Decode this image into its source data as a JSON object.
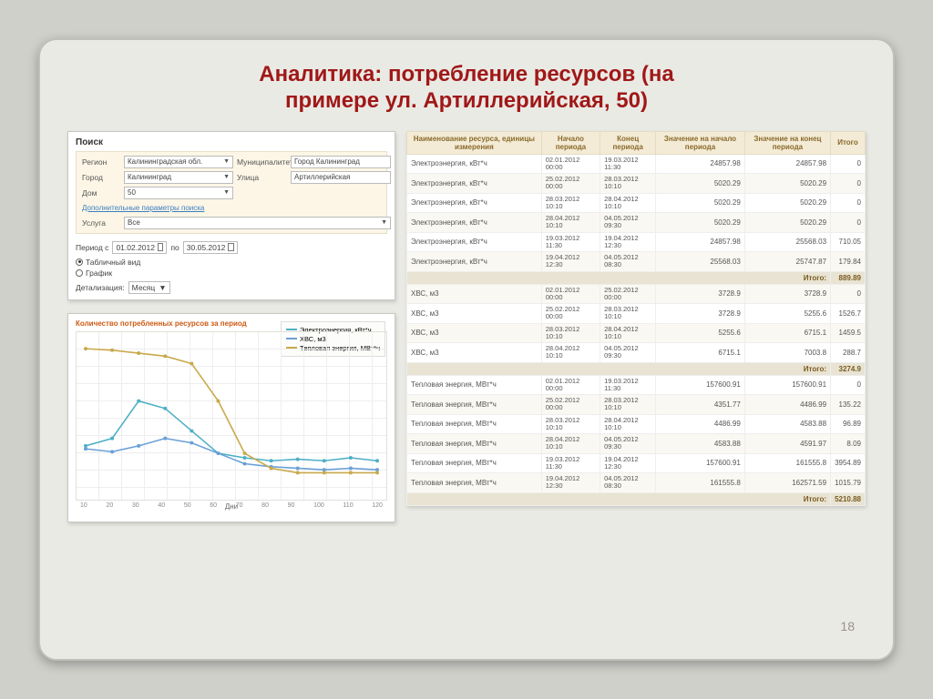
{
  "title_line1": "Аналитика: потребление ресурсов (на",
  "title_line2": "примере ул. Артиллерийская, 50)",
  "page_number": "18",
  "search": {
    "header": "Поиск",
    "region_lbl": "Регион",
    "region_val": "Калининградская обл.",
    "muni_lbl": "Муниципалитет",
    "muni_val": "Город Калининград",
    "city_lbl": "Город",
    "city_val": "Калининград",
    "street_lbl": "Улица",
    "street_val": "Артиллерийская",
    "house_lbl": "Дом",
    "house_val": "50",
    "extra_link": "Дополнительные параметры поиска",
    "service_lbl": "Услуга",
    "service_val": "Все",
    "period_lbl": "Период с",
    "date_from": "01.02.2012",
    "to_lbl": "по",
    "date_to": "30.05.2012",
    "view_table": "Табличный вид",
    "view_chart": "График",
    "detal_lbl": "Детализация:",
    "detal_val": "Месяц"
  },
  "chart": {
    "title": "Количество потребленных ресурсов за период",
    "x_label": "Дни",
    "legend": [
      {
        "name": "Электроэнергия, кВт*ч",
        "color": "#4fb0c6"
      },
      {
        "name": "ХВС, м3",
        "color": "#6aa0d8"
      },
      {
        "name": "Тепловая энергия, МВт*ч",
        "color": "#c9a94b"
      }
    ]
  },
  "chart_data": {
    "type": "line",
    "x": [
      10,
      20,
      30,
      40,
      50,
      60,
      70,
      80,
      90,
      100,
      110,
      120
    ],
    "series": [
      {
        "name": "Электроэнергия, кВт*ч",
        "color": "#4fb0c6",
        "values": [
          30,
          35,
          60,
          55,
          40,
          25,
          22,
          20,
          21,
          20,
          22,
          20
        ]
      },
      {
        "name": "ХВС, м3",
        "color": "#6aa0d8",
        "values": [
          28,
          26,
          30,
          35,
          32,
          25,
          18,
          16,
          15,
          14,
          15,
          14
        ]
      },
      {
        "name": "Тепловая энергия, МВт*ч",
        "color": "#c9a94b",
        "values": [
          95,
          94,
          92,
          90,
          85,
          60,
          25,
          15,
          12,
          12,
          12,
          12
        ]
      }
    ],
    "xlabel": "Дни",
    "ylabel": "",
    "ylim": [
      0,
      100
    ]
  },
  "table": {
    "headers": [
      "Наименование ресурса, единицы измерения",
      "Начало периода",
      "Конец периода",
      "Значение на начало периода",
      "Значение на конец периода",
      "Итого"
    ],
    "groups": [
      {
        "rows": [
          [
            "Электроэнергия, кВт*ч",
            "02.01.2012 00:00",
            "19.03.2012 11:30",
            "24857.98",
            "24857.98",
            "0"
          ],
          [
            "Электроэнергия, кВт*ч",
            "25.02.2012 00:00",
            "28.03.2012 10:10",
            "5020.29",
            "5020.29",
            "0"
          ],
          [
            "Электроэнергия, кВт*ч",
            "28.03.2012 10:10",
            "28.04.2012 10:10",
            "5020.29",
            "5020.29",
            "0"
          ],
          [
            "Электроэнергия, кВт*ч",
            "28.04.2012 10:10",
            "04.05.2012 09:30",
            "5020.29",
            "5020.29",
            "0"
          ],
          [
            "Электроэнергия, кВт*ч",
            "19.03.2012 11:30",
            "19.04.2012 12:30",
            "24857.98",
            "25568.03",
            "710.05"
          ],
          [
            "Электроэнергия, кВт*ч",
            "19.04.2012 12:30",
            "04.05.2012 08:30",
            "25568.03",
            "25747.87",
            "179.84"
          ]
        ],
        "subtotal_label": "Итого:",
        "subtotal": "889.89"
      },
      {
        "rows": [
          [
            "ХВС, м3",
            "02.01.2012 00:00",
            "25.02.2012 00:00",
            "3728.9",
            "3728.9",
            "0"
          ],
          [
            "ХВС, м3",
            "25.02.2012 00:00",
            "28.03.2012 10:10",
            "3728.9",
            "5255.6",
            "1526.7"
          ],
          [
            "ХВС, м3",
            "28.03.2012 10:10",
            "28.04.2012 10:10",
            "5255.6",
            "6715.1",
            "1459.5"
          ],
          [
            "ХВС, м3",
            "28.04.2012 10:10",
            "04.05.2012 09:30",
            "6715.1",
            "7003.8",
            "288.7"
          ]
        ],
        "subtotal_label": "Итого:",
        "subtotal": "3274.9"
      },
      {
        "rows": [
          [
            "Тепловая энергия, МВт*ч",
            "02.01.2012 00:00",
            "19.03.2012 11:30",
            "157600.91",
            "157600.91",
            "0"
          ],
          [
            "Тепловая энергия, МВт*ч",
            "25.02.2012 00:00",
            "28.03.2012 10:10",
            "4351.77",
            "4486.99",
            "135.22"
          ],
          [
            "Тепловая энергия, МВт*ч",
            "28.03.2012 10:10",
            "28.04.2012 10:10",
            "4486.99",
            "4583.88",
            "96.89"
          ],
          [
            "Тепловая энергия, МВт*ч",
            "28.04.2012 10:10",
            "04.05.2012 09:30",
            "4583.88",
            "4591.97",
            "8.09"
          ],
          [
            "Тепловая энергия, МВт*ч",
            "19.03.2012 11:30",
            "19.04.2012 12:30",
            "157600.91",
            "161555.8",
            "3954.89"
          ],
          [
            "Тепловая энергия, МВт*ч",
            "19.04.2012 12:30",
            "04.05.2012 08:30",
            "161555.8",
            "162571.59",
            "1015.79"
          ]
        ],
        "subtotal_label": "Итого:",
        "subtotal": "5210.88"
      }
    ]
  }
}
